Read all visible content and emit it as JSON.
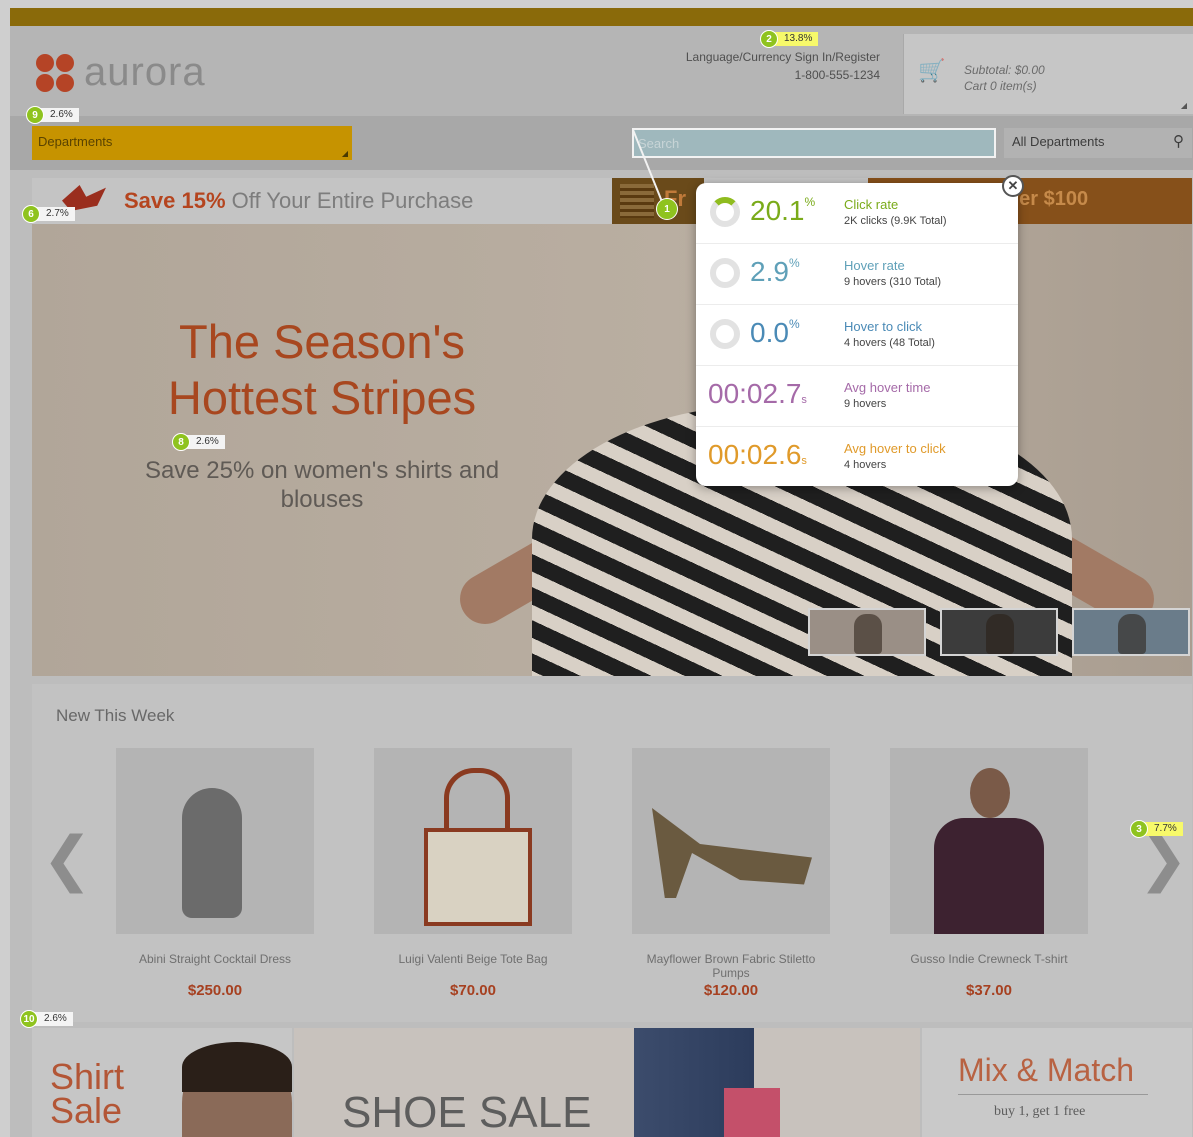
{
  "header": {
    "logo_text": "aurora",
    "utility_line": "Language/Currency  Sign In/Register",
    "phone": "1-800-555-1234",
    "cart_subtotal": "Subtotal: $0.00",
    "cart_items": "Cart 0 item(s)"
  },
  "nav": {
    "departments_label": "Departments",
    "search_placeholder": "Search",
    "all_departments_label": "All Departments"
  },
  "promo": {
    "save_bold": "Save 15%",
    "save_rest": "Off Your Entire Purchase",
    "mid_text": "Fr",
    "right_text": "ver $100"
  },
  "hero": {
    "title": "The Season's Hottest Stripes",
    "subtitle": "Save 25% on women's shirts and blouses"
  },
  "new_this_week": {
    "title": "New This Week",
    "products": [
      {
        "name": "Abini Straight Cocktail Dress",
        "price": "$250.00"
      },
      {
        "name": "Luigi Valenti Beige Tote Bag",
        "price": "$70.00"
      },
      {
        "name": "Mayflower Brown Fabric Stiletto Pumps",
        "price": "$120.00"
      },
      {
        "name": "Gusso Indie Crewneck T-shirt",
        "price": "$37.00"
      }
    ]
  },
  "bottom": {
    "shirt_sale": "Shirt Sale",
    "shoe_sale": "SHOE SALE",
    "mix_title": "Mix & Match",
    "mix_sub": "buy 1, get 1 free"
  },
  "markers": [
    {
      "num": "2",
      "pct": "13.8%"
    },
    {
      "num": "9",
      "pct": "2.6%"
    },
    {
      "num": "6",
      "pct": "2.7%"
    },
    {
      "num": "1",
      "pct": ""
    },
    {
      "num": "8",
      "pct": "2.6%"
    },
    {
      "num": "3",
      "pct": "7.7%"
    },
    {
      "num": "10",
      "pct": "2.6%"
    }
  ],
  "popup": {
    "stats": [
      {
        "value": "20.1",
        "sup": "%",
        "label": "Click rate",
        "detail": "2K clicks (9.9K Total)",
        "color": "#7aab1a"
      },
      {
        "value": "2.9",
        "sup": "%",
        "label": "Hover rate",
        "detail": "9 hovers (310 Total)",
        "color": "#5fa0b8"
      },
      {
        "value": "0.0",
        "sup": "%",
        "label": "Hover to click",
        "detail": "4 hovers (48 Total)",
        "color": "#4a8ab6"
      },
      {
        "value": "00:02.7",
        "sup": "s",
        "label": "Avg hover time",
        "detail": "9 hovers",
        "color": "#a56aa8"
      },
      {
        "value": "00:02.6",
        "sup": "s",
        "label": "Avg hover to click",
        "detail": "4 hovers",
        "color": "#e09a2a"
      }
    ]
  }
}
